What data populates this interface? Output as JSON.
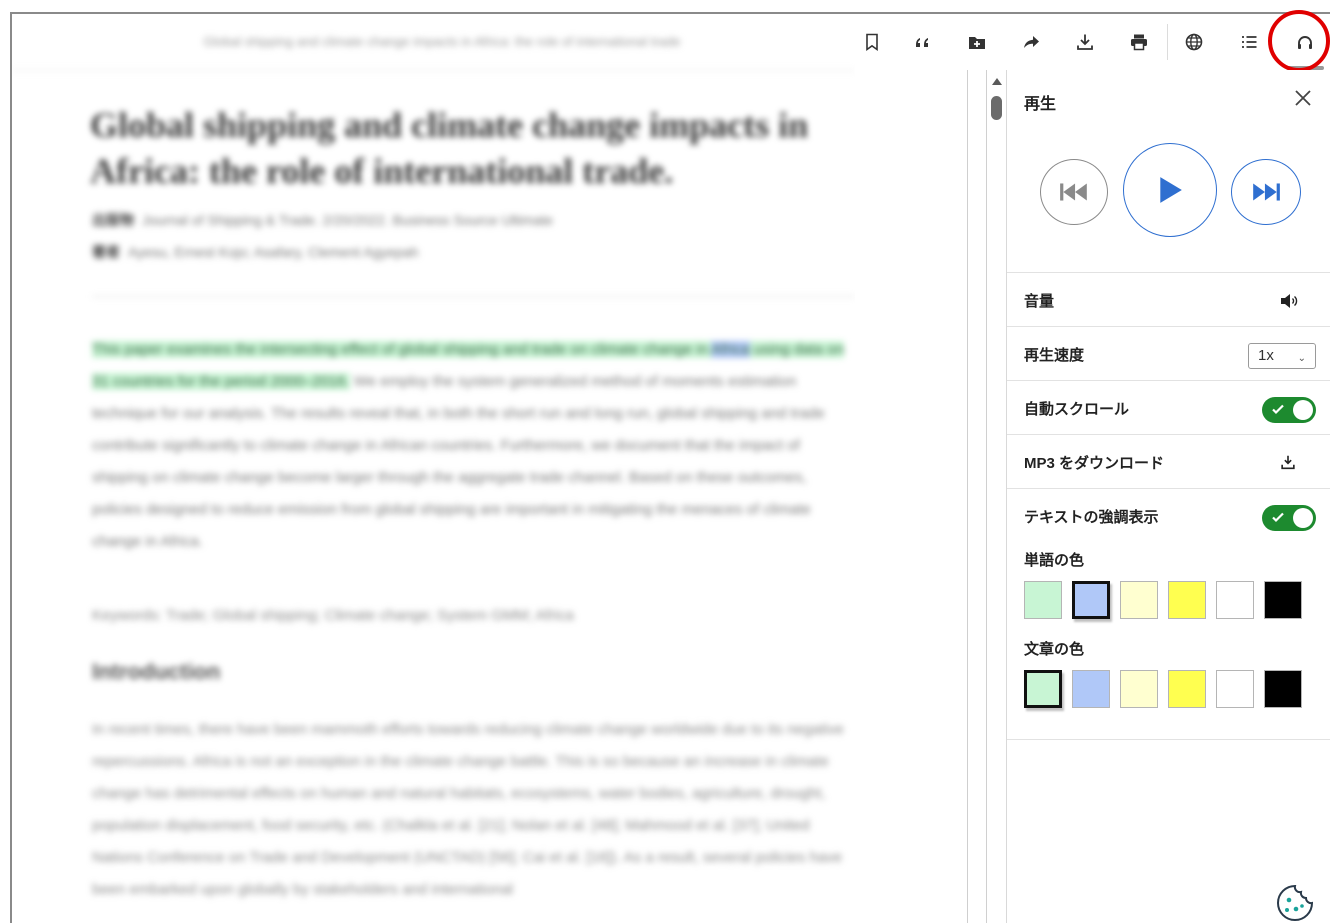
{
  "article": {
    "running_title": "Global shipping and climate change impacts in Africa: the role of international trade",
    "title": "Global shipping and climate change impacts in Africa: the role of international trade.",
    "meta": [
      {
        "label": "出版物",
        "value": "Journal of Shipping & Trade. 2/20/2022. Business Source Ultimate"
      },
      {
        "label": "著者",
        "value": "Ayesu, Ernest Kojo; Asafary, Clement Agyepah"
      }
    ],
    "abstract_sentence_before": "This paper examines the intersecting effect of global shipping and trade on climate change in",
    "abstract_word": "Africa",
    "abstract_sentence_after": "using data on 31 countries for the period 2000–2016.",
    "abstract_rest": "We employ the system generalized method of moments estimation technique for our analysis. The results reveal that, in both the short run and long run, global shipping and trade contribute significantly to climate change in African countries. Furthermore, we document that the impact of shipping on climate change become larger through the aggregate trade channel. Based on these outcomes, policies designed to reduce emission from global shipping are important in mitigating the menaces of climate change in Africa.",
    "keywords": "Keywords: Trade; Global shipping; Climate change; System GMM; Africa",
    "section_heading": "Introduction",
    "intro": "In recent times, there have been mammoth efforts towards reducing climate change worldwide due to its negative repercussions. Africa is not an exception in the climate change battle. This is so because an increase in climate change has detrimental effects on human and natural habitats, ecosystems, water bodies, agriculture, drought, population displacement, food security, etc. (Chalkla et al. [21]; Nolan et al. [48]; Mahmood et al. [37]; United Nations Conference on Trade and Development (UNCTAD) [56]; Cai et al. [16]). As a result, several policies have been embarked upon globally by stakeholders and international"
  },
  "toolbar": {
    "buttons": [
      {
        "name": "bookmark-icon"
      },
      {
        "name": "cite-icon"
      },
      {
        "name": "add-to-folder-icon"
      },
      {
        "name": "share-icon"
      },
      {
        "name": "download-icon"
      },
      {
        "name": "print-icon"
      },
      {
        "name": "translate-icon"
      },
      {
        "name": "table-of-contents-icon"
      },
      {
        "name": "listen-icon"
      }
    ]
  },
  "panel": {
    "title": "再生",
    "volume_label": "音量",
    "speed_label": "再生速度",
    "speed_value": "1x",
    "autoscroll_label": "自動スクロール",
    "autoscroll_on": true,
    "mp3_label": "MP3 をダウンロード",
    "highlight_label": "テキストの強調表示",
    "highlight_on": true,
    "word_color_label": "単語の色",
    "sentence_color_label": "文章の色",
    "word_colors": [
      "#c8f5d4",
      "#b0c8f8",
      "#ffffd0",
      "#ffff50",
      "#ffffff",
      "#000000"
    ],
    "word_color_selected": 1,
    "sentence_colors": [
      "#c8f5d4",
      "#b0c8f8",
      "#ffffd0",
      "#ffff50",
      "#ffffff",
      "#000000"
    ],
    "sentence_color_selected": 0
  },
  "colors": {
    "accent": "#2f6fd0",
    "toggle_on": "#1d8a2f",
    "annotation_circle": "#e00000"
  }
}
